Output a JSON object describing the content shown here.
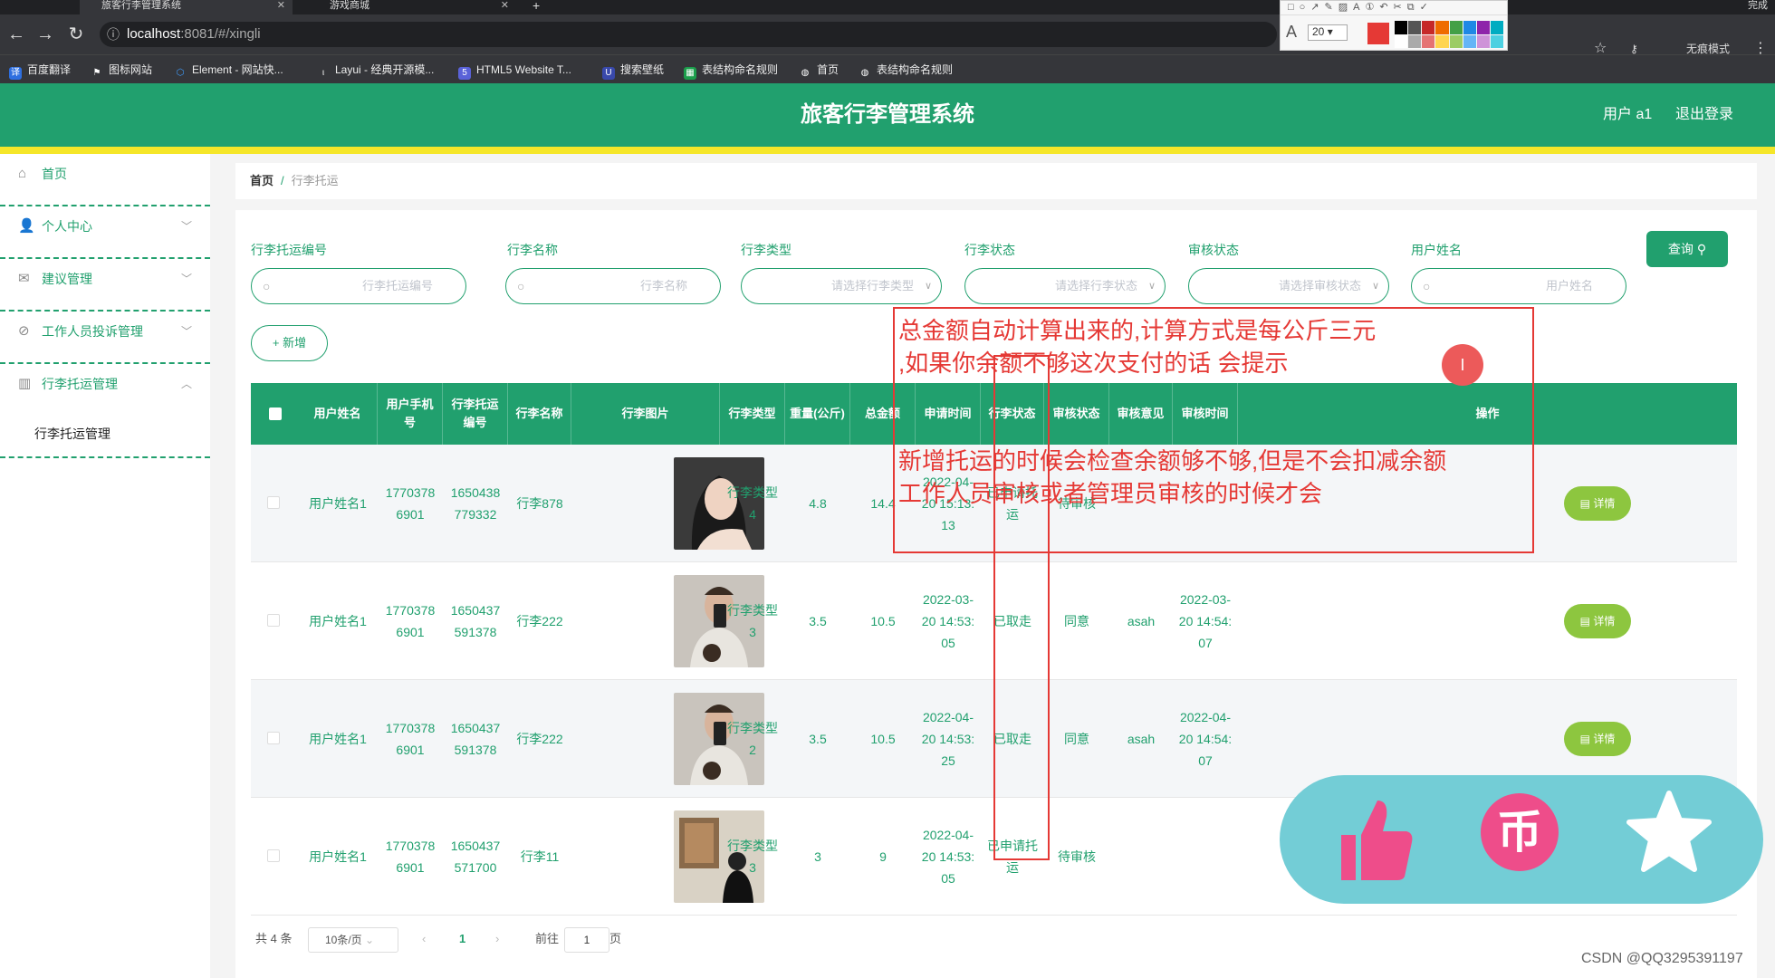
{
  "browser": {
    "tabs": [
      {
        "title": "旅客行李管理系统",
        "active": true
      },
      {
        "title": "游戏商城",
        "active": false
      }
    ],
    "url_host": "localhost",
    "url_path": ":8081/#/xingli",
    "incognito_label": "无痕模式",
    "right_edge_label": "完成",
    "bookmarks": [
      "百度翻译",
      "图标网站",
      "Element - 网站快...",
      "Layui - 经典开源模...",
      "HTML5 Website T...",
      "搜索壁纸",
      "表结构命名规则",
      "首页",
      "表结构命名规则"
    ],
    "annot_toolbar": {
      "font_size": "20",
      "current_color": "#e53935"
    }
  },
  "header": {
    "title": "旅客行李管理系统",
    "user": "用户 a1",
    "logout": "退出登录",
    "colors": {
      "primary": "#21a06e",
      "accent_line": "#f5e629",
      "detail_button": "#8dc63f"
    }
  },
  "sidebar": {
    "items": [
      {
        "label": "首页",
        "icon": "home-icon"
      },
      {
        "label": "个人中心",
        "icon": "user-icon"
      },
      {
        "label": "建议管理",
        "icon": "suggestion-icon"
      },
      {
        "label": "工作人员投诉管理",
        "icon": "complaint-icon"
      },
      {
        "label": "行李托运管理",
        "icon": "chart-icon"
      }
    ],
    "sub_item": "行李托运管理"
  },
  "breadcrumb": {
    "home": "首页",
    "sep": "/",
    "current": "行李托运"
  },
  "filters": {
    "fields": [
      {
        "label": "行李托运编号",
        "placeholder": "行李托运编号",
        "kind": "input"
      },
      {
        "label": "行李名称",
        "placeholder": "行李名称",
        "kind": "input"
      },
      {
        "label": "行李类型",
        "placeholder": "请选择行李类型",
        "kind": "select"
      },
      {
        "label": "行李状态",
        "placeholder": "请选择行李状态",
        "kind": "select"
      },
      {
        "label": "审核状态",
        "placeholder": "请选择审核状态",
        "kind": "select"
      },
      {
        "label": "用户姓名",
        "placeholder": "用户姓名",
        "kind": "input"
      }
    ],
    "query_label": "查询",
    "add_label": "+ 新增"
  },
  "table": {
    "headers": [
      "用户姓名",
      "用户手机号",
      "行李托运编号",
      "行李名称",
      "行李图片",
      "行李类型",
      "重量(公斤)",
      "总金额",
      "申请时间",
      "行李状态",
      "审核状态",
      "审核意见",
      "审核时间",
      "操作"
    ],
    "rows": [
      {
        "user": "用户姓名1",
        "phone": "17703786901",
        "no": "1650438779332",
        "name": "行李878",
        "type": "行李类型4",
        "weight": "4.8",
        "total": "14.4",
        "apply_time": "2022-04-20 15:13:13",
        "status": "已申请托运",
        "audit": "待审核",
        "opinion": "",
        "audit_time": "",
        "photo": "woman-portrait"
      },
      {
        "user": "用户姓名1",
        "phone": "17703786901",
        "no": "1650437591378",
        "name": "行李222",
        "type": "行李类型3",
        "weight": "3.5",
        "total": "10.5",
        "apply_time": "2022-03-20 14:53:05",
        "status": "已取走",
        "audit": "同意",
        "opinion": "asah",
        "audit_time": "2022-03-20 14:54:07",
        "photo": "mirror-selfie"
      },
      {
        "user": "用户姓名1",
        "phone": "17703786901",
        "no": "1650437591378",
        "name": "行李222",
        "type": "行李类型2",
        "weight": "3.5",
        "total": "10.5",
        "apply_time": "2022-04-20 14:53:25",
        "status": "已取走",
        "audit": "同意",
        "opinion": "asah",
        "audit_time": "2022-04-20 14:54:07",
        "photo": "mirror-selfie"
      },
      {
        "user": "用户姓名1",
        "phone": "17703786901",
        "no": "1650437571700",
        "name": "行李11",
        "type": "行李类型3",
        "weight": "3",
        "total": "9",
        "apply_time": "2022-04-20 14:53:05",
        "status": "已申请托运",
        "audit": "待审核",
        "opinion": "",
        "audit_time": "",
        "photo": "gallery-man"
      }
    ],
    "detail_label": "详情"
  },
  "pagination": {
    "total": "共 4 条",
    "page_size": "10条/页",
    "current": "1",
    "goto": "前往",
    "goto_value": "1",
    "page_unit": "页"
  },
  "annotations": {
    "line1": "总金额自动计算出来的,计算方式是每公斤三元",
    "line2": ",如果你余额不够这次支付的话 会提示",
    "line3": "新增托运的时候会检查余额够不够,但是不会扣减余额",
    "line4": "工作人员审核或者管理员审核的时候才会"
  },
  "watermark": "CSDN @QQ3295391197"
}
